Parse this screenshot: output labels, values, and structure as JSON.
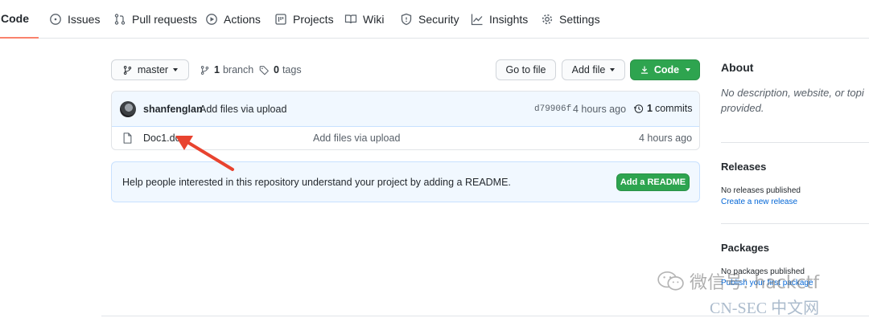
{
  "nav": {
    "items": [
      {
        "label": "Code"
      },
      {
        "label": "Issues"
      },
      {
        "label": "Pull requests"
      },
      {
        "label": "Actions"
      },
      {
        "label": "Projects"
      },
      {
        "label": "Wiki"
      },
      {
        "label": "Security"
      },
      {
        "label": "Insights"
      },
      {
        "label": "Settings"
      }
    ],
    "active": "Code",
    "accent": "#f9826c"
  },
  "toolbar": {
    "branch_select": "master",
    "branches_count": "1",
    "branches_label": "branch",
    "tags_count": "0",
    "tags_label": "tags",
    "go_to_file": "Go to file",
    "add_file": "Add file",
    "code": "Code"
  },
  "commit": {
    "author": "shanfenglan",
    "message": "Add files via upload",
    "sha": "d79906f",
    "time": "4 hours ago",
    "commits_count": "1",
    "commits_label": "commits"
  },
  "files": [
    {
      "name": "Doc1.do",
      "message": "Add files via upload",
      "time": "4 hours ago",
      "icon": "file-icon"
    }
  ],
  "readme_banner": {
    "text": "Help people interested in this repository understand your project by adding a README.",
    "button": "Add a README"
  },
  "sidebar": {
    "about_title": "About",
    "about_text_line1": "No description, website, or topi",
    "about_text_line2": "provided.",
    "releases_title": "Releases",
    "releases_text": "No releases published",
    "releases_link": "Create a new release",
    "packages_title": "Packages",
    "packages_text": "No packages published",
    "packages_link": "Publish your first package"
  },
  "watermark": {
    "wechat": "微信号: hackctf",
    "site": "CN-SEC 中文网"
  },
  "colors": {
    "green": "#2ea44f",
    "link": "#0366d6",
    "banner_bg": "#f1f8ff",
    "arrow": "#e8432f"
  }
}
